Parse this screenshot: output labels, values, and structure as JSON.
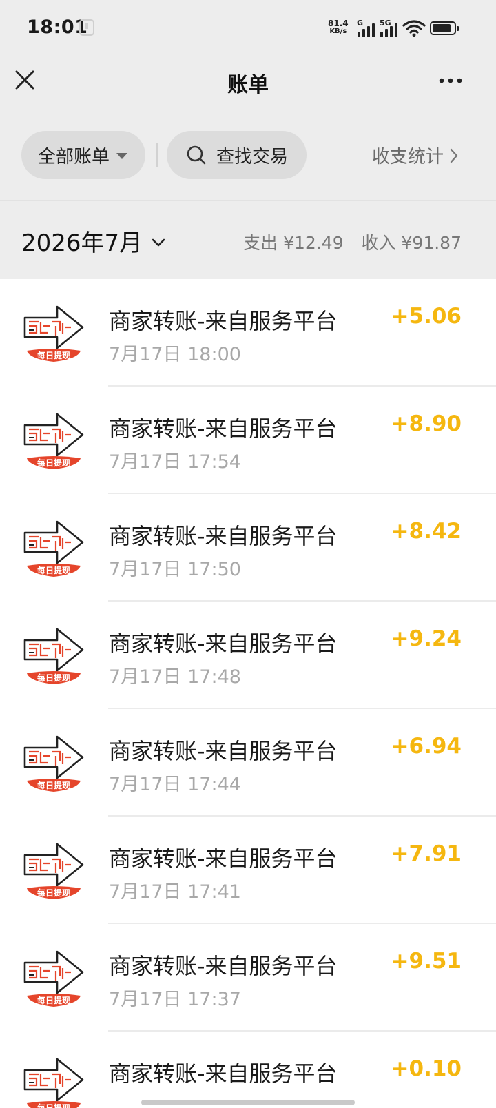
{
  "status_bar": {
    "time": "18:01",
    "net_speed_value": "81.4",
    "net_speed_unit": "KB/s",
    "sim1_label": "G",
    "sim2_label": "5G",
    "icons": [
      "download-icon",
      "signal-icon",
      "wifi-icon",
      "battery-icon"
    ],
    "battery_level": 0.85
  },
  "nav": {
    "title": "账单",
    "close_icon": "close-icon",
    "more_icon": "more-icon"
  },
  "filters": {
    "all_bills_label": "全部账单",
    "search_label": "查找交易",
    "stats_label": "收支统计"
  },
  "month": {
    "label": "2026年7月",
    "expense": "支出 ¥12.49",
    "income": "收入 ¥91.87"
  },
  "colors": {
    "accent_amount": "#f5b710",
    "header_bg": "#ededed",
    "logo_red": "#e5452b"
  },
  "transactions": [
    {
      "title": "商家转账-来自服务平台",
      "time": "7月17日 18:00",
      "amount": "+5.06"
    },
    {
      "title": "商家转账-来自服务平台",
      "time": "7月17日 17:54",
      "amount": "+8.90"
    },
    {
      "title": "商家转账-来自服务平台",
      "time": "7月17日 17:50",
      "amount": "+8.42"
    },
    {
      "title": "商家转账-来自服务平台",
      "time": "7月17日 17:48",
      "amount": "+9.24"
    },
    {
      "title": "商家转账-来自服务平台",
      "time": "7月17日 17:44",
      "amount": "+6.94"
    },
    {
      "title": "商家转账-来自服务平台",
      "time": "7月17日 17:41",
      "amount": "+7.91"
    },
    {
      "title": "商家转账-来自服务平台",
      "time": "7月17日 17:37",
      "amount": "+9.51"
    },
    {
      "title": "商家转账-来自服务平台",
      "time": "",
      "amount": "+0.10"
    }
  ],
  "logo_caption": "每日提现"
}
